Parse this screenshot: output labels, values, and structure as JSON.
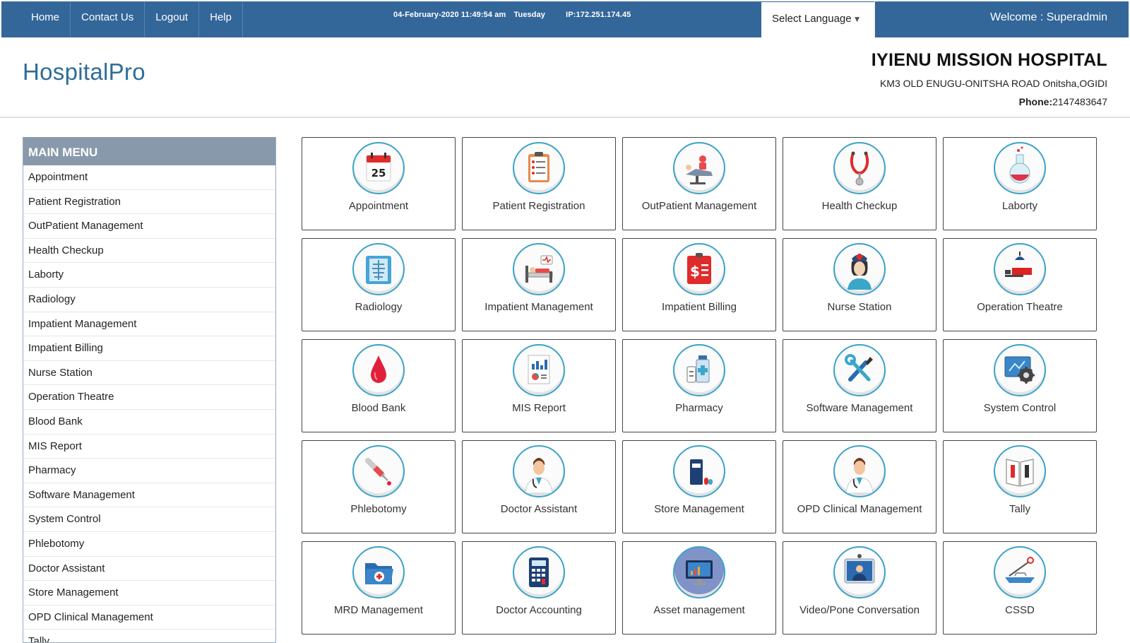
{
  "topbar": {
    "nav": [
      "Home",
      "Contact Us",
      "Logout",
      "Help"
    ],
    "date": "04-February-2020 11:49:54 am",
    "day": "Tuesday",
    "ip": "IP:172.251.174.45",
    "language_label": "Select Language",
    "welcome": "Welcome : Superadmin",
    "color": "#336699"
  },
  "header": {
    "brand": "HospitalPro",
    "hospital_name": "IYIENU MISSION HOSPITAL",
    "address": "KM3 OLD ENUGU-ONITSHA ROAD Onitsha,OGIDI",
    "phone_label": "Phone:",
    "phone": "2147483647"
  },
  "sidebar": {
    "title": "MAIN MENU",
    "items": [
      "Appointment",
      "Patient Registration",
      "OutPatient Management",
      "Health Checkup",
      "Laborty",
      "Radiology",
      "Impatient Management",
      "Impatient Billing",
      "Nurse Station",
      "Operation Theatre",
      "Blood Bank",
      "MIS Report",
      "Pharmacy",
      "Software Management",
      "System Control",
      "Phlebotomy",
      "Doctor Assistant",
      "Store Management",
      "OPD Clinical Management",
      "Tally"
    ]
  },
  "tiles": [
    {
      "label": "Appointment",
      "icon": "calendar-icon"
    },
    {
      "label": "Patient Registration",
      "icon": "clipboard-icon"
    },
    {
      "label": "OutPatient Management",
      "icon": "dental-chair-icon"
    },
    {
      "label": "Health Checkup",
      "icon": "stethoscope-icon"
    },
    {
      "label": "Laborty",
      "icon": "flask-icon"
    },
    {
      "label": "Radiology",
      "icon": "xray-icon"
    },
    {
      "label": "Impatient Management",
      "icon": "hospital-bed-icon"
    },
    {
      "label": "Impatient Billing",
      "icon": "bill-icon"
    },
    {
      "label": "Nurse Station",
      "icon": "nurse-icon"
    },
    {
      "label": "Operation Theatre",
      "icon": "operation-icon"
    },
    {
      "label": "Blood Bank",
      "icon": "blood-drop-icon"
    },
    {
      "label": "MIS Report",
      "icon": "report-icon"
    },
    {
      "label": "Pharmacy",
      "icon": "medicine-bottle-icon"
    },
    {
      "label": "Software Management",
      "icon": "tools-icon"
    },
    {
      "label": "System Control",
      "icon": "system-gear-icon"
    },
    {
      "label": "Phlebotomy",
      "icon": "syringe-icon"
    },
    {
      "label": "Doctor Assistant",
      "icon": "doctor-icon"
    },
    {
      "label": "Store Management",
      "icon": "store-icon"
    },
    {
      "label": "OPD Clinical Management",
      "icon": "doctor-icon"
    },
    {
      "label": "Tally",
      "icon": "tally-book-icon"
    },
    {
      "label": "MRD Management",
      "icon": "medical-folder-icon"
    },
    {
      "label": "Doctor Accounting",
      "icon": "calculator-icon"
    },
    {
      "label": "Asset management",
      "icon": "monitor-icon"
    },
    {
      "label": "Video/Pone Conversation",
      "icon": "video-call-icon"
    },
    {
      "label": "CSSD",
      "icon": "sterilization-tray-icon"
    }
  ]
}
